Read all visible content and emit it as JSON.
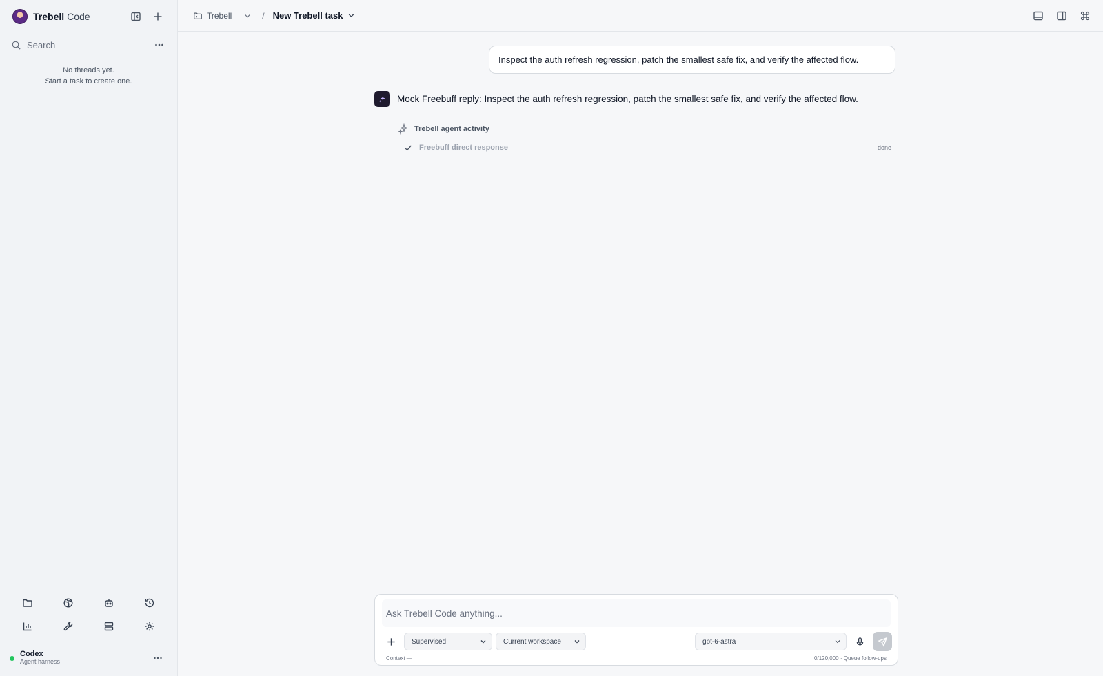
{
  "app": {
    "brand_bold": "Trebell",
    "brand_light": "Code"
  },
  "sidebar": {
    "search_placeholder": "Search",
    "empty_line1": "No threads yet.",
    "empty_line2": "Start a task to create one.",
    "tools": [
      "folder-icon",
      "globe-icon",
      "bot-icon",
      "history-icon",
      "chart-icon",
      "wrench-icon",
      "server-icon",
      "gear-icon"
    ],
    "footer": {
      "title": "Codex",
      "subtitle": "Agent harness",
      "status_color": "#22c55e"
    }
  },
  "topbar": {
    "project": "Trebell",
    "separator": "/",
    "task": "New Trebell task"
  },
  "conversation": {
    "user_message": "Inspect the auth refresh regression, patch the smallest safe fix, and verify the affected flow.",
    "assistant_message": "Mock Freebuff reply: Inspect the auth refresh regression, patch the smallest safe fix, and verify the affected flow.",
    "activity": {
      "title": "Trebell agent activity",
      "items": [
        {
          "label": "Freebuff direct response",
          "status": "done"
        }
      ]
    }
  },
  "composer": {
    "placeholder": "Ask Trebell Code anything...",
    "mode": "Supervised",
    "workspace": "Current workspace",
    "model": "gpt-6-astra",
    "context": "Context —",
    "token_info": "0/120,000 · Queue follow-ups"
  }
}
